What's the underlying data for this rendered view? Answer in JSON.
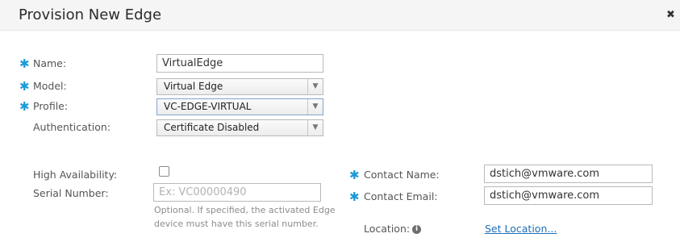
{
  "dialog": {
    "title": "Provision New Edge",
    "close_glyph": "✖"
  },
  "form": {
    "name": {
      "label": "Name:",
      "value": "VirtualEdge",
      "required": true
    },
    "model": {
      "label": "Model:",
      "value": "Virtual Edge",
      "required": true
    },
    "profile": {
      "label": "Profile:",
      "value": "VC-EDGE-VIRTUAL",
      "required": true
    },
    "authentication": {
      "label": "Authentication:",
      "value": "Certificate Disabled"
    },
    "high_availability": {
      "label": "High Availability:",
      "checked": false
    },
    "serial_number": {
      "label": "Serial Number:",
      "value": "",
      "placeholder": "Ex: VC00000490",
      "hint": "Optional. If specified, the activated Edge device must have this serial number."
    },
    "contact_name": {
      "label": "Contact Name:",
      "value": "dstich@vmware.com",
      "required": true
    },
    "contact_email": {
      "label": "Contact Email:",
      "value": "dstich@vmware.com",
      "required": true
    },
    "location": {
      "label": "Location:",
      "info_icon": "info-icon",
      "link": "Set Location..."
    }
  },
  "icons": {
    "required_marker": "✱",
    "dropdown_arrow": "▼",
    "info": "i"
  },
  "colors": {
    "required": "#1a9ad8",
    "link": "#1d6fb8",
    "header_bg": "#f5f5f5"
  }
}
